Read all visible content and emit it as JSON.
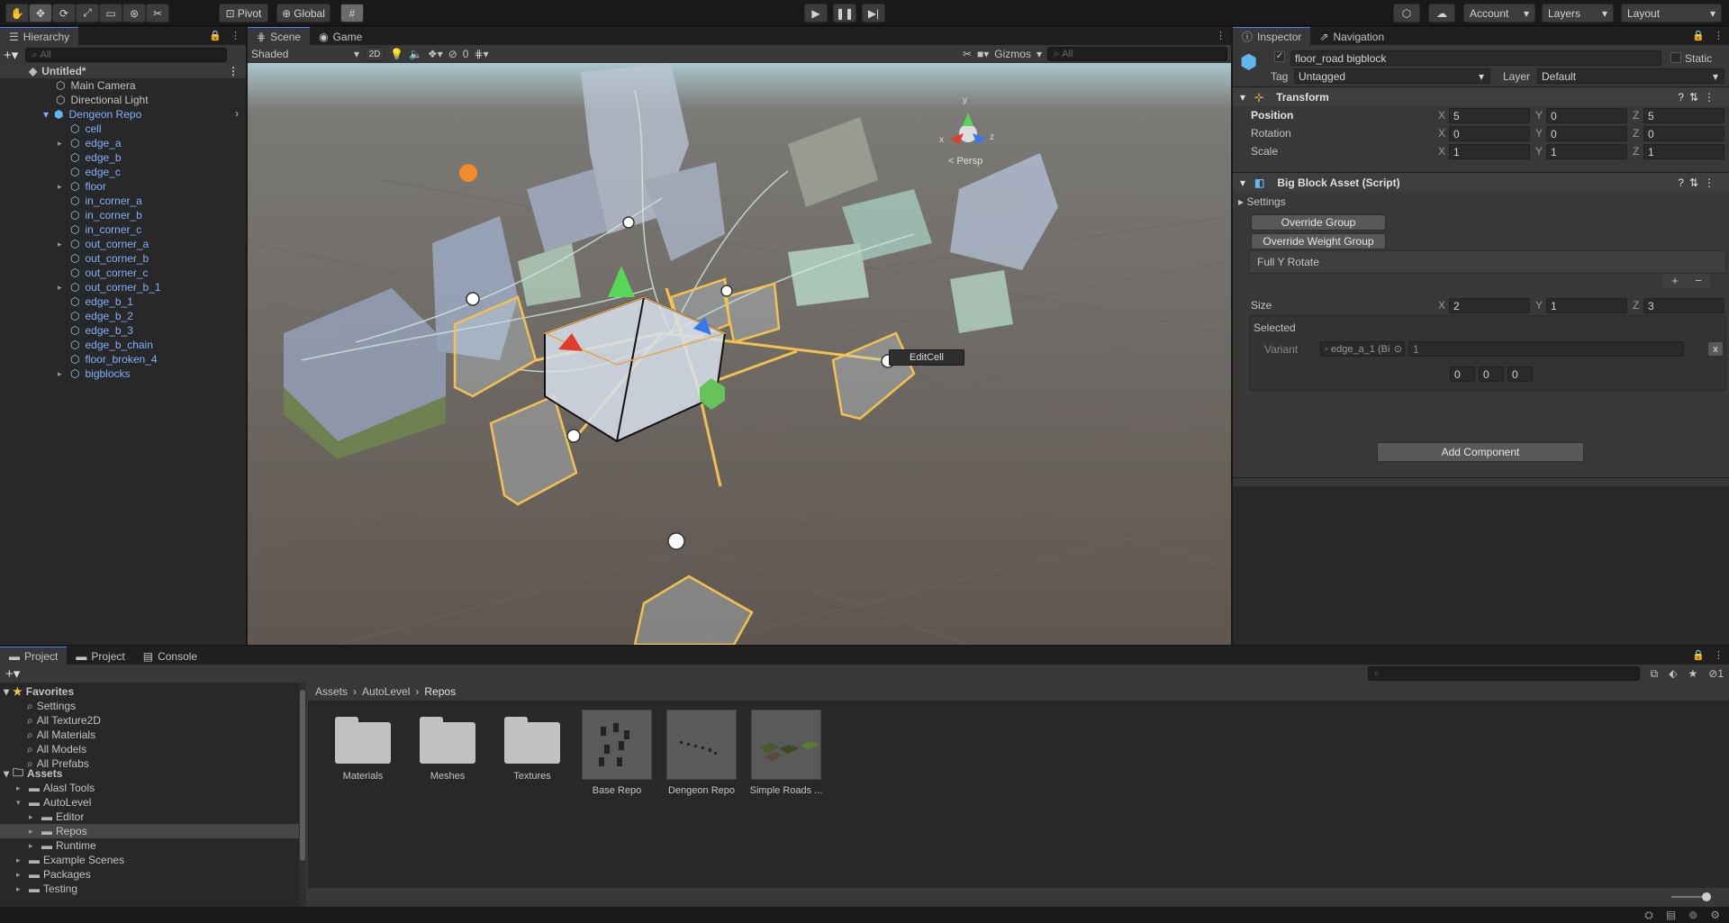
{
  "toolbar": {
    "pivot_label": "Pivot",
    "global_label": "Global",
    "account_label": "Account",
    "layers_label": "Layers",
    "layout_label": "Layout"
  },
  "hierarchy": {
    "tab_label": "Hierarchy",
    "search_placeholder": "All",
    "scene_name": "Untitled*",
    "items": [
      "Main Camera",
      "Directional Light",
      "Dengeon Repo"
    ],
    "children": [
      "cell",
      "edge_a",
      "edge_b",
      "edge_c",
      "floor",
      "in_corner_a",
      "in_corner_b",
      "in_corner_c",
      "out_corner_a",
      "out_corner_b",
      "out_corner_c",
      "out_corner_b_1",
      "edge_b_1",
      "edge_b_2",
      "edge_b_3",
      "edge_b_chain",
      "floor_broken_4",
      "bigblocks"
    ]
  },
  "scene": {
    "tab_scene": "Scene",
    "tab_game": "Game",
    "shading_mode": "Shaded",
    "mode_2d": "2D",
    "hidden_count": "0",
    "gizmos_label": "Gizmos",
    "search_placeholder": "All",
    "persp_label": "< Persp",
    "editcell_label": "EditCell",
    "axis_x": "x",
    "axis_y": "y",
    "axis_z": "z"
  },
  "inspector": {
    "tab_inspector": "Inspector",
    "tab_navigation": "Navigation",
    "object_name": "floor_road bigblock",
    "static_label": "Static",
    "tag_label": "Tag",
    "tag_value": "Untagged",
    "layer_label": "Layer",
    "layer_value": "Default",
    "transform": {
      "title": "Transform",
      "position_label": "Position",
      "rotation_label": "Rotation",
      "scale_label": "Scale",
      "pos": [
        "5",
        "0",
        "5"
      ],
      "rot": [
        "0",
        "0",
        "0"
      ],
      "scl": [
        "1",
        "1",
        "1"
      ]
    },
    "script": {
      "title": "Big Block Asset (Script)",
      "settings_label": "Settings",
      "override_group": "Override Group",
      "override_weight_group": "Override Weight Group",
      "list_item": "Full Y Rotate",
      "size_label": "Size",
      "size": [
        "2",
        "1",
        "3"
      ],
      "selected_label": "Selected",
      "variant_label": "Variant",
      "variant_value": "edge_a_1 (Bi",
      "variant_weight": "1",
      "variant_remove": "x",
      "offset": [
        "0",
        "0",
        "0"
      ]
    },
    "add_component": "Add Component",
    "axis": [
      "X",
      "Y",
      "Z"
    ]
  },
  "project": {
    "tab_project1": "Project",
    "tab_project2": "Project",
    "tab_console": "Console",
    "favorites_label": "Favorites",
    "favorites": [
      "Settings",
      "All Texture2D",
      "All Materials",
      "All Models",
      "All Prefabs"
    ],
    "assets_label": "Assets",
    "tree": [
      "Alasl Tools",
      "AutoLevel",
      "Editor",
      "Repos",
      "Runtime",
      "Example Scenes",
      "Packages",
      "Testing"
    ],
    "breadcrumb": [
      "Assets",
      "AutoLevel",
      "Repos"
    ],
    "assets": [
      "Materials",
      "Meshes",
      "Textures",
      "Base Repo",
      "Dengeon Repo",
      "Simple Roads ..."
    ],
    "visible_count": "1"
  },
  "colors": {
    "accent": "#4c7fff",
    "selection": "#2c5d87",
    "gizmo_yellow": "#f2c14e"
  }
}
